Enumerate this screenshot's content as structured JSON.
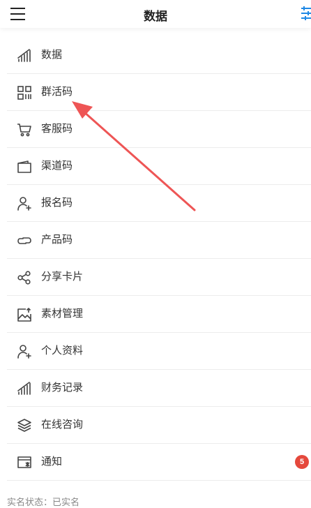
{
  "header": {
    "title": "数据"
  },
  "menu": {
    "items": [
      {
        "label": "数据",
        "icon": "chart-bars-icon"
      },
      {
        "label": "群活码",
        "icon": "qr-grid-icon"
      },
      {
        "label": "客服码",
        "icon": "shopping-cart-icon"
      },
      {
        "label": "渠道码",
        "icon": "wallet-icon"
      },
      {
        "label": "报名码",
        "icon": "user-add-icon"
      },
      {
        "label": "产品码",
        "icon": "link-icon"
      },
      {
        "label": "分享卡片",
        "icon": "share-icon"
      },
      {
        "label": "素材管理",
        "icon": "image-upload-icon"
      },
      {
        "label": "个人资料",
        "icon": "user-add-icon"
      },
      {
        "label": "财务记录",
        "icon": "chart-bars-icon"
      },
      {
        "label": "在线咨询",
        "icon": "layers-icon"
      },
      {
        "label": "通知",
        "icon": "notification-card-icon",
        "badge": "5"
      }
    ]
  },
  "footer": {
    "status": "实名状态：已实名"
  },
  "colors": {
    "accent_blue": "#1e88e5",
    "badge_red": "#e5483c",
    "annotation_red": "#ee5555"
  }
}
